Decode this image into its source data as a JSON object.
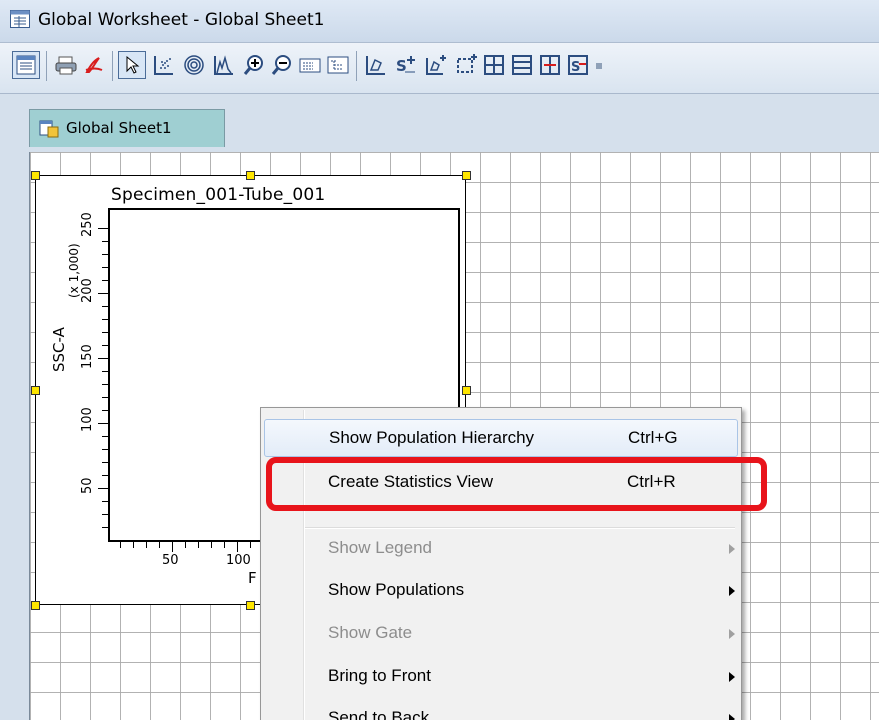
{
  "window": {
    "title": "Global Worksheet - Global Sheet1",
    "title_icon": "worksheet-icon"
  },
  "toolbar": {
    "buttons": [
      {
        "name": "worksheet-icon"
      },
      {
        "name": "print-icon"
      },
      {
        "name": "pdf-icon"
      },
      {
        "name": "pointer-icon"
      },
      {
        "name": "dot-plot-icon"
      },
      {
        "name": "contour-plot-icon"
      },
      {
        "name": "histogram-icon"
      },
      {
        "name": "zoom-in-icon"
      },
      {
        "name": "zoom-out-icon"
      },
      {
        "name": "statistics-icon"
      },
      {
        "name": "hierarchy-icon"
      },
      {
        "name": "polygon-gate-icon"
      },
      {
        "name": "snap-to-gate-icon"
      },
      {
        "name": "autopolygon-gate-icon"
      },
      {
        "name": "rectangle-gate-icon"
      },
      {
        "name": "quadrant-gate-icon"
      },
      {
        "name": "interval-gate-icon"
      },
      {
        "name": "binary-gate-icon"
      },
      {
        "name": "snap-interval-gate-icon"
      }
    ]
  },
  "tabs": [
    {
      "label": "Global Sheet1",
      "icon": "sheet-icon",
      "active": true
    }
  ],
  "plot": {
    "title": "Specimen_001-Tube_001",
    "y_axis_label": "SSC-A",
    "y_axis_unit": "(x 1,000)",
    "y_ticks": [
      "250",
      "200",
      "150",
      "100",
      "50"
    ],
    "x_ticks": [
      "50",
      "100"
    ],
    "x_axis_label_partial": "F"
  },
  "context_menu": {
    "items": [
      {
        "label": "Show Population Hierarchy",
        "shortcut": "Ctrl+G",
        "enabled": true,
        "submenu": false
      },
      {
        "label": "Create Statistics View",
        "shortcut": "Ctrl+R",
        "enabled": true,
        "submenu": false
      },
      {
        "label": "Show Legend",
        "shortcut": "",
        "enabled": false,
        "submenu": true
      },
      {
        "label": "Show Populations",
        "shortcut": "",
        "enabled": true,
        "submenu": true
      },
      {
        "label": "Show Gate",
        "shortcut": "",
        "enabled": false,
        "submenu": true
      },
      {
        "label": "Bring to Front",
        "shortcut": "",
        "enabled": true,
        "submenu": true
      },
      {
        "label": "Send to Back",
        "shortcut": "",
        "enabled": true,
        "submenu": true
      }
    ]
  },
  "colors": {
    "highlight_outline": "#e8141b",
    "selection_handle": "#ffe600",
    "tab_active": "#9fcfd2"
  }
}
